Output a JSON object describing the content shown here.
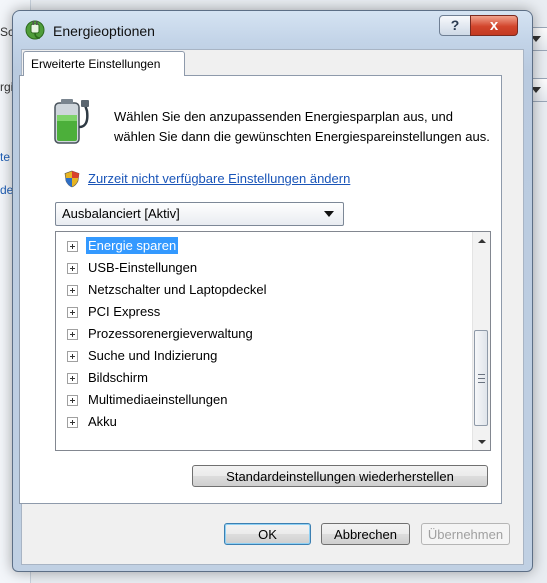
{
  "background": {
    "fragments": [
      "Sc",
      "rgi"
    ],
    "links": [
      "te",
      "dei"
    ]
  },
  "dialog": {
    "title": "Energieoptionen",
    "help_button": "?",
    "close_button": "x"
  },
  "tab": {
    "label": "Erweiterte Einstellungen"
  },
  "intro": {
    "description": "Wählen Sie den anzupassenden Energiesparplan aus, und wählen Sie dann die gewünschten Energiespareinstellungen aus.",
    "change_link": "Zurzeit nicht verfügbare Einstellungen ändern"
  },
  "plan_select": {
    "value": "Ausbalanciert [Aktiv]"
  },
  "tree": {
    "items": [
      {
        "label": "Energie sparen",
        "selected": true
      },
      {
        "label": "USB-Einstellungen"
      },
      {
        "label": "Netzschalter und Laptopdeckel"
      },
      {
        "label": "PCI Express"
      },
      {
        "label": "Prozessorenergieverwaltung"
      },
      {
        "label": "Suche und Indizierung"
      },
      {
        "label": "Bildschirm"
      },
      {
        "label": "Multimediaeinstellungen"
      },
      {
        "label": "Akku"
      }
    ]
  },
  "buttons": {
    "restore": "Standardeinstellungen wiederherstellen",
    "ok": "OK",
    "cancel": "Abbrechen",
    "apply": "Übernehmen"
  },
  "colors": {
    "selection": "#3399ff",
    "link": "#1a55b8",
    "close_red": "#d2452c"
  }
}
